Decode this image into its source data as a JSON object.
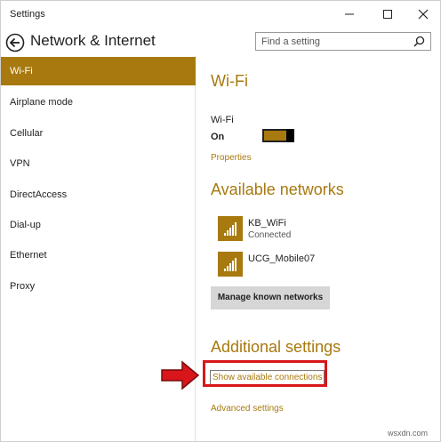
{
  "window": {
    "title": "Settings"
  },
  "header": {
    "page_title": "Network & Internet",
    "search_placeholder": "Find a setting"
  },
  "sidebar": {
    "items": [
      {
        "label": "Wi-Fi",
        "active": true
      },
      {
        "label": "Airplane mode",
        "active": false
      },
      {
        "label": "Cellular",
        "active": false
      },
      {
        "label": "VPN",
        "active": false
      },
      {
        "label": "DirectAccess",
        "active": false
      },
      {
        "label": "Dial-up",
        "active": false
      },
      {
        "label": "Ethernet",
        "active": false
      },
      {
        "label": "Proxy",
        "active": false
      }
    ]
  },
  "main": {
    "heading": "Wi-Fi",
    "wifi_label": "Wi-Fi",
    "wifi_state": "On",
    "toggle_on": true,
    "properties_link": "Properties",
    "available_heading": "Available networks",
    "networks": [
      {
        "name": "KB_WiFi",
        "status": "Connected",
        "icon": "wifi-signal-icon"
      },
      {
        "name": "UCG_Mobile07",
        "status": "",
        "icon": "wifi-signal-icon"
      }
    ],
    "manage_button": "Manage known networks",
    "additional_heading": "Additional settings",
    "show_connections_link": "Show available connections",
    "advanced_link": "Advanced settings"
  },
  "watermark": "wsxdn.com",
  "colors": {
    "accent": "#a8790e",
    "highlight": "#d8161b"
  }
}
